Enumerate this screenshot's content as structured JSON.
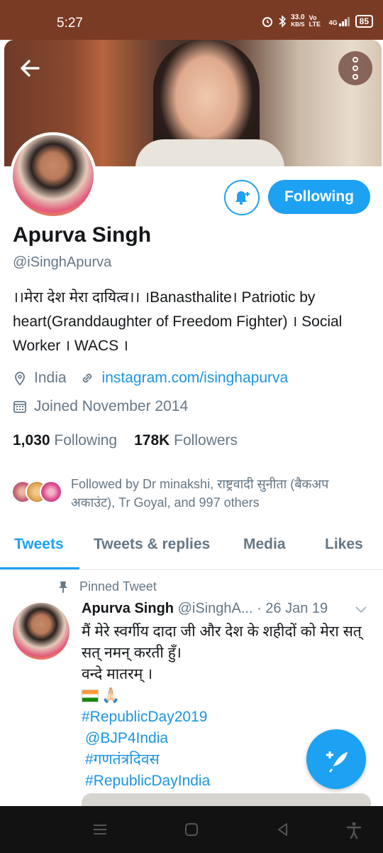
{
  "status_bar": {
    "time": "5:27",
    "net_speed": "33.0",
    "net_unit": "KB/S",
    "volte": "Vo LTE",
    "signal": "4G",
    "battery": "85"
  },
  "profile": {
    "name": "Apurva Singh",
    "handle": "@iSinghApurva",
    "bio": "।।मेरा देश मेरा दायित्व।। ।Banasthalite। Patriotic by heart(Granddaughter of Freedom Fighter) । Social Worker । WACS ।",
    "location": "India",
    "website": "instagram.com/isinghapurva",
    "joined": "Joined November 2014",
    "following_count": "1,030",
    "following_label": "Following",
    "followers_count": "178K",
    "followers_label": "Followers",
    "followed_by": "Followed by Dr minakshi, राष्ट्रवादी सुनीता (बैकअप अकाउंट), Tr Goyal, and 997 others"
  },
  "actions": {
    "follow_button": "Following"
  },
  "tabs": [
    {
      "label": "Tweets",
      "active": true
    },
    {
      "label": "Tweets & replies",
      "active": false
    },
    {
      "label": "Media",
      "active": false
    },
    {
      "label": "Likes",
      "active": false
    }
  ],
  "pinned_tweet": {
    "pinned_label": "Pinned Tweet",
    "author_name": "Apurva Singh",
    "author_handle": "@iSinghA...",
    "date": "· 26 Jan 19",
    "line1": "मैं मेरे स्वर्गीय दादा जी और देश के शहीदों को मेरा सत् सत् नमन् करती हुँ।",
    "line2": "वन्दे मातरम् ।",
    "emoji": "🙏🏻",
    "hashtags": [
      "#RepublicDay2019",
      "@BJP4India",
      "#गणतंत्रदिवस",
      "#RepublicDayIndia"
    ]
  },
  "colors": {
    "accent": "#1da1f2",
    "link": "#1b95e0",
    "secondary_text": "#657786",
    "status_bar": "#7a3b24"
  },
  "icons": {
    "back": "arrow-left-icon",
    "more": "more-vertical-icon",
    "bell": "bell-plus-icon",
    "location": "location-pin-icon",
    "link": "link-icon",
    "calendar": "calendar-icon",
    "pin": "pin-icon",
    "chevron": "chevron-down-icon",
    "compose": "compose-feather-icon"
  }
}
